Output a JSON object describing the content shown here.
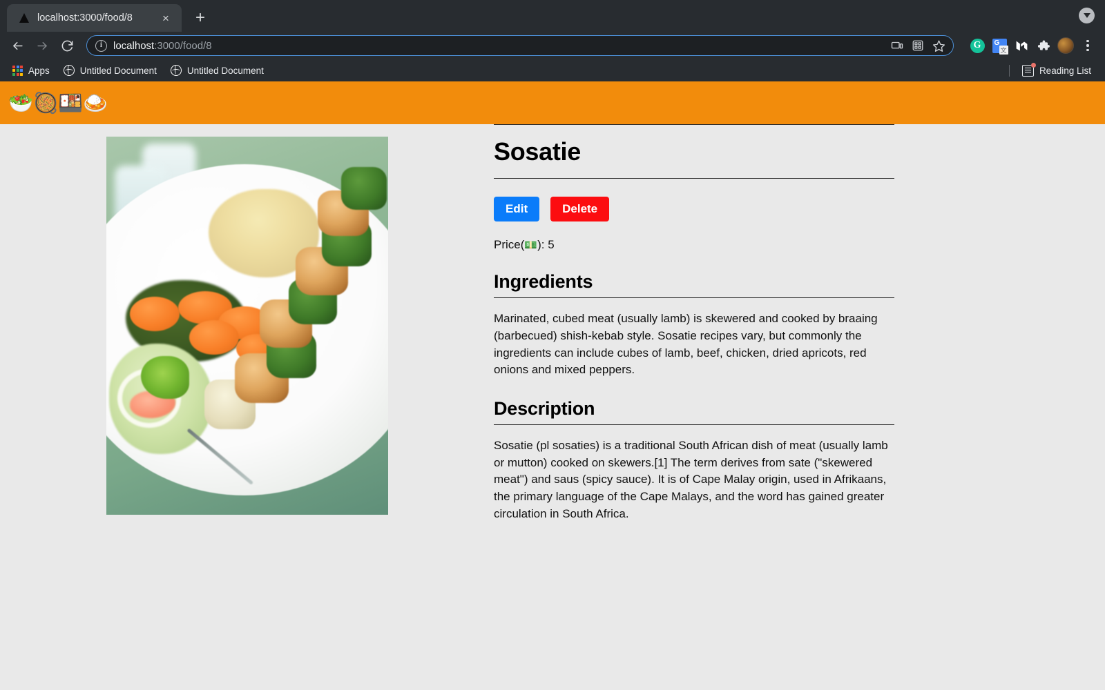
{
  "browser": {
    "tab": {
      "title": "localhost:3000/food/8",
      "favicon": "triangle-logo-icon",
      "close_label": "×"
    },
    "new_tab_label": "+",
    "tab_search_icon": "chevron-down-icon",
    "nav": {
      "back_icon": "arrow-left-icon",
      "forward_icon": "arrow-right-icon",
      "reload_icon": "reload-icon"
    },
    "omnibox": {
      "info_icon": "info-circle-icon",
      "url_host": "localhost",
      "url_path": ":3000/food/8",
      "full_url": "localhost:3000/food/8",
      "actions": [
        "cast-icon",
        "qr-code-icon",
        "bookmark-star-icon"
      ]
    },
    "extensions": [
      {
        "name": "grammarly-icon",
        "glyph": "G",
        "color": "#15c39a"
      },
      {
        "name": "google-translate-icon",
        "glyph": "G",
        "color": "#4285f4"
      },
      {
        "name": "medium-icon",
        "glyph": "M",
        "color": "#ffffff"
      },
      {
        "name": "extensions-puzzle-icon",
        "glyph": "❖",
        "color": "#e8eaed"
      }
    ],
    "profile_icon": "avatar",
    "menu_icon": "three-dot-menu-icon",
    "bookmarks": {
      "apps_label": "Apps",
      "items": [
        {
          "label": "Untitled Document",
          "icon": "globe-icon"
        },
        {
          "label": "Untitled Document",
          "icon": "globe-icon"
        }
      ],
      "reading_list_label": "Reading List",
      "reading_list_icon": "reading-list-icon"
    }
  },
  "page": {
    "header": {
      "background_color": "#f28c0c",
      "emoji_nav": [
        "🥗",
        "🥘",
        "🍱",
        "🍛"
      ]
    },
    "photo": {
      "alt": "Sosatie skewers on a white plate with mashed potato, carrots, spinach and salad"
    },
    "dish": {
      "title": "Sosatie",
      "edit_label": "Edit",
      "delete_label": "Delete",
      "edit_color": "#0a7cfa",
      "delete_color": "#fc0d10",
      "price_prefix": "Price(",
      "price_emoji": "💵",
      "price_suffix": "): 5",
      "price_value": "5"
    },
    "sections": [
      {
        "heading": "Ingredients",
        "body": "Marinated, cubed meat (usually lamb) is skewered and cooked by braaing (barbecued) shish-kebab style. Sosatie recipes vary, but commonly the ingredients can include cubes of lamb, beef, chicken, dried apricots, red onions and mixed peppers."
      },
      {
        "heading": "Description",
        "body": "Sosatie (pl sosaties) is a traditional South African dish of meat (usually lamb or mutton) cooked on skewers.[1] The term derives from sate (\"skewered meat\") and saus (spicy sauce). It is of Cape Malay origin, used in Afrikaans, the primary language of the Cape Malays, and the word has gained greater circulation in South Africa."
      }
    ]
  }
}
